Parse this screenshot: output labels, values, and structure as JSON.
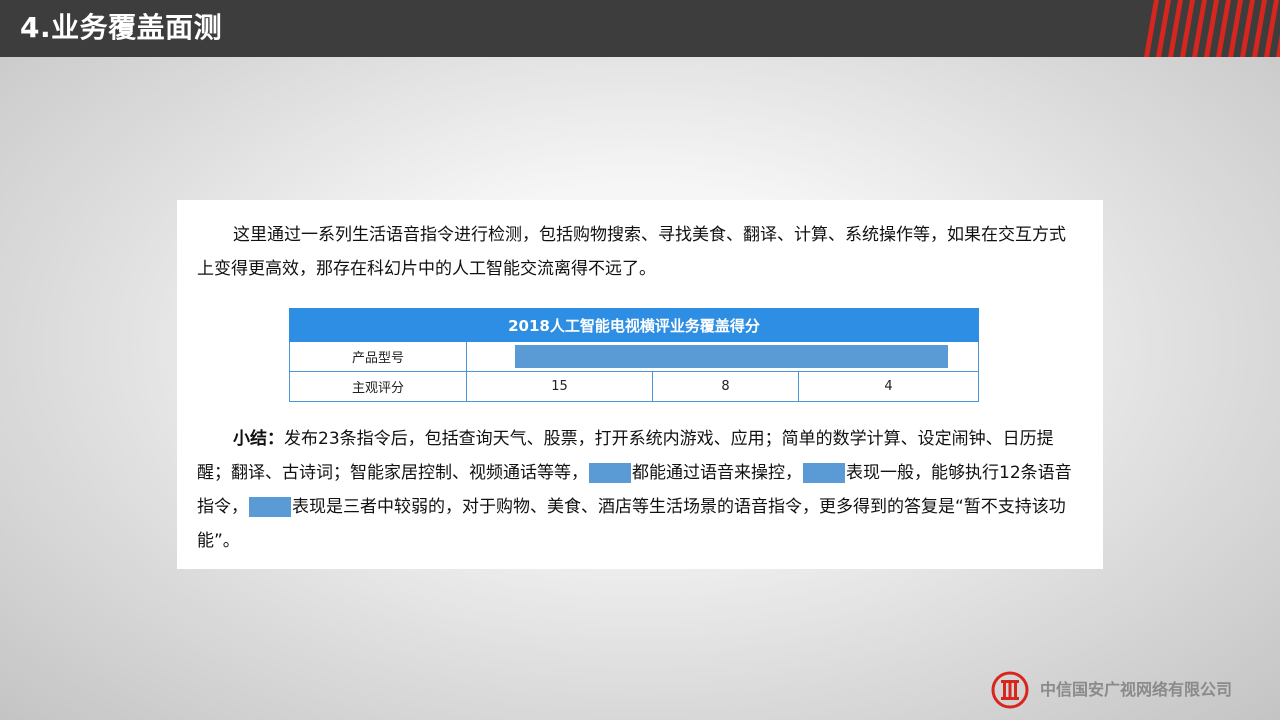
{
  "header": {
    "title": "4.业务覆盖面测"
  },
  "intro": {
    "text": "这里通过一系列生活语音指令进行检测，包括购物搜索、寻找美食、翻译、计算、系统操作等，如果在交互方式上变得更高效，那存在科幻片中的人工智能交流离得不远了。"
  },
  "table": {
    "title": "2018人工智能电视横评业务覆盖得分",
    "rows": [
      {
        "label": "产品型号"
      },
      {
        "label": "主观评分",
        "values": [
          "15",
          "8",
          "4"
        ]
      }
    ]
  },
  "summary": {
    "label": "小结：",
    "part1": "发布23条指令后，包括查询天气、股票，打开系统内游戏、应用；简单的数学计算、设定闹钟、日历提醒；翻译、古诗词；智能家居控制、视频通话等等，",
    "part2": "都能通过语音来操控，",
    "part3": "表现一般，能够执行12条语音指令，",
    "part4": "表现是三者中较弱的，对于购物、美食、酒店等生活场景的语音指令，更多得到的答复是“暂不支持该功能”。"
  },
  "footer": {
    "company": "中信国安广视网络有限公司"
  },
  "colors": {
    "header_bg": "#3d3d3d",
    "accent_red": "#d7261e",
    "table_header": "#2e8ee3",
    "redaction_blue": "#5b9bd5"
  },
  "icons": {
    "logo": "citic-logo-icon",
    "stripes": "red-stripes-decoration"
  }
}
